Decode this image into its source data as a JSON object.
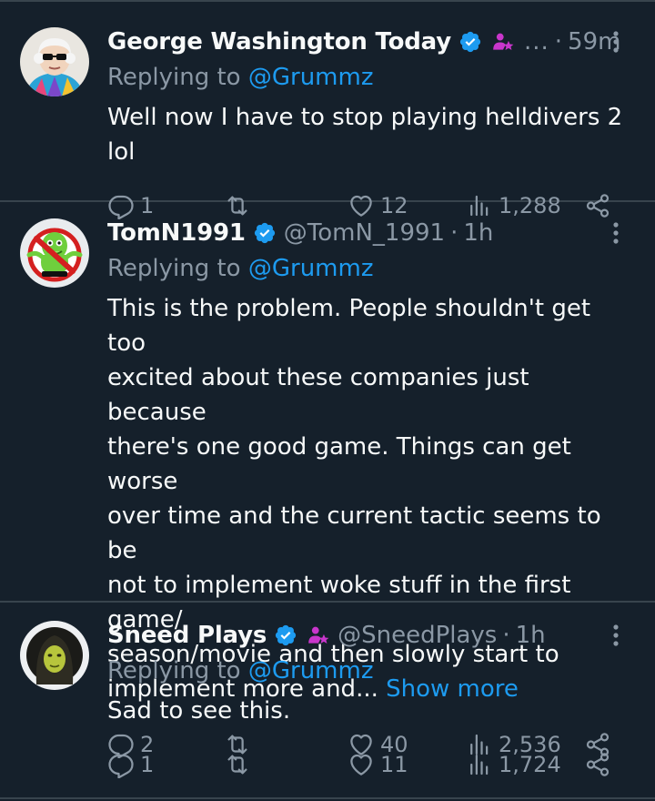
{
  "tweets": [
    {
      "name": "George Washington Today",
      "handle": "",
      "separator": "·",
      "ellipsis": "...",
      "time": "59m",
      "replying_prefix": "Replying to ",
      "replying_to": "@Grummz",
      "text": "Well now I have to stop playing helldivers 2 lol",
      "show_more": "",
      "replies": "1",
      "retweets": "",
      "likes": "12",
      "views": "1,288"
    },
    {
      "name": "TomN1991",
      "handle": "@TomN_1991",
      "separator": "·",
      "time": "1h",
      "replying_prefix": "Replying to ",
      "replying_to": "@Grummz",
      "text": "This is the problem. People shouldn't get too\nexcited about these companies just because\nthere's one good game. Things can get worse\nover time and the current tactic seems to be\nnot to implement woke stuff in the first game/\nseason/movie and then slowly start to\nimplement more and... ",
      "show_more": "Show more",
      "replies": "2",
      "retweets": "",
      "likes": "40",
      "views": "2,536"
    },
    {
      "name": "Sneed Plays",
      "handle": "@SneedPlays",
      "separator": "·",
      "time": "1h",
      "replying_prefix": "Replying to ",
      "replying_to": "@Grummz",
      "text": "Sad to see this.",
      "show_more": "",
      "replies": "1",
      "retweets": "",
      "likes": "11",
      "views": "1,724"
    }
  ],
  "icons": {
    "verified": "verified-badge-icon",
    "affiliate": "affiliate-person-icon",
    "more": "more-vertical-icon",
    "reply": "reply-icon",
    "retweet": "retweet-icon",
    "like": "heart-icon",
    "views": "views-bar-chart-icon",
    "share": "share-icon"
  },
  "colors": {
    "background": "#15202b",
    "text": "#f7f9f9",
    "muted": "#8b98a5",
    "link": "#1d9bf0",
    "divider": "#38444d",
    "affiliate_badge": "#c936cc"
  }
}
